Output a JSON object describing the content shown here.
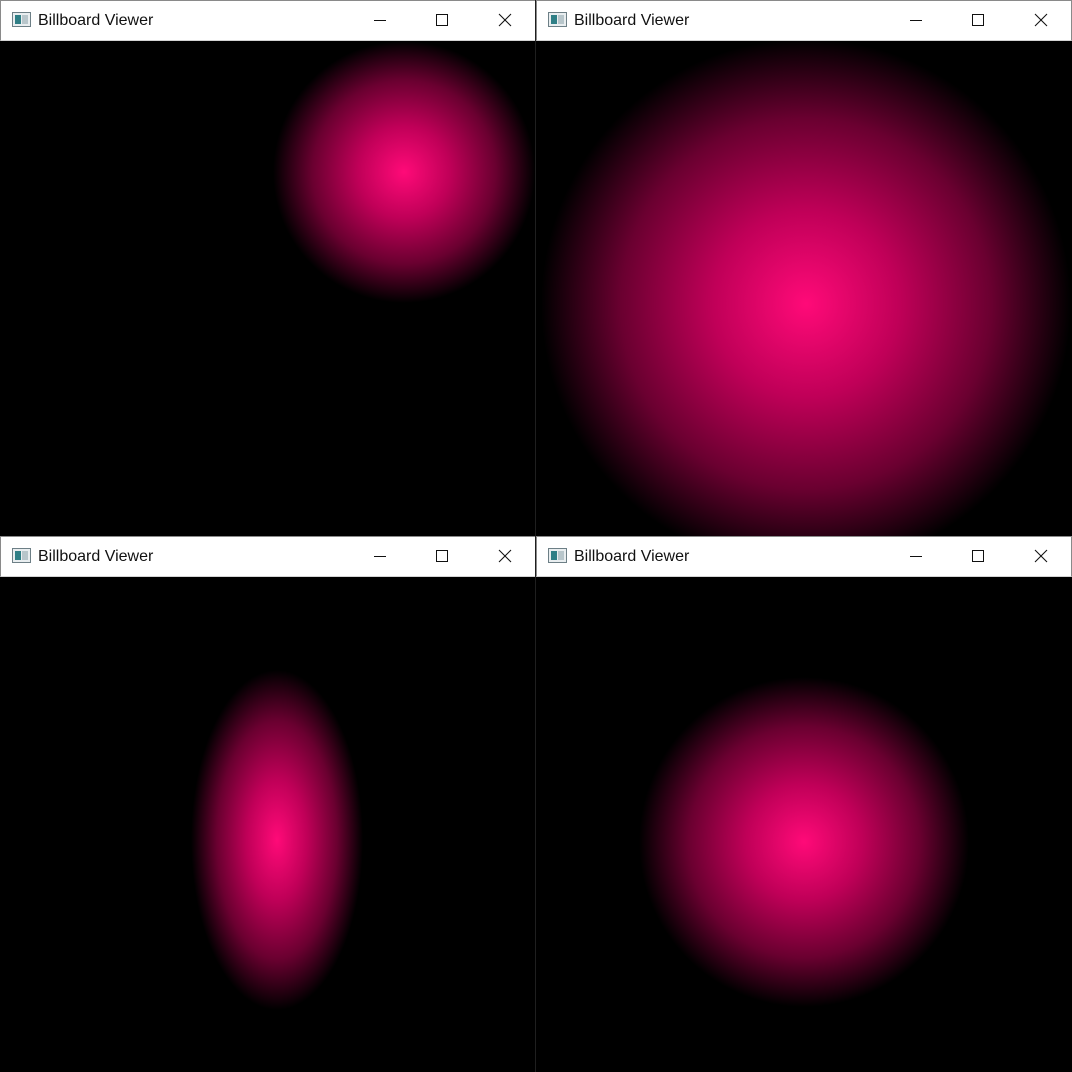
{
  "windows": [
    {
      "title": "Billboard Viewer",
      "icons": {
        "app": "app-window-icon",
        "minimize": "minimize-icon",
        "maximize": "maximize-icon",
        "close": "close-icon"
      }
    },
    {
      "title": "Billboard Viewer",
      "icons": {
        "app": "app-window-icon",
        "minimize": "minimize-icon",
        "maximize": "maximize-icon",
        "close": "close-icon"
      }
    },
    {
      "title": "Billboard Viewer",
      "icons": {
        "app": "app-window-icon",
        "minimize": "minimize-icon",
        "maximize": "maximize-icon",
        "close": "close-icon"
      }
    },
    {
      "title": "Billboard Viewer",
      "icons": {
        "app": "app-window-icon",
        "minimize": "minimize-icon",
        "maximize": "maximize-icon",
        "close": "close-icon"
      }
    }
  ],
  "colors": {
    "billboard_center": "#ff0a78",
    "background": "#000000",
    "titlebar": "#ffffff"
  }
}
